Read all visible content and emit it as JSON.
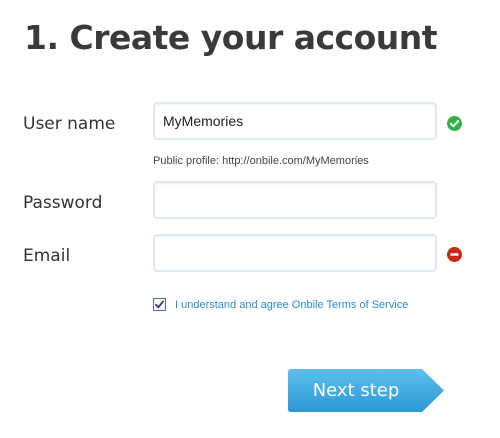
{
  "header": {
    "title": "1. Create your account"
  },
  "form": {
    "username": {
      "label": "User name",
      "value": "MyMemories",
      "status": "valid",
      "hint": "Public profile: http://onbile.com/MyMemories"
    },
    "password": {
      "label": "Password",
      "value": ""
    },
    "email": {
      "label": "Email",
      "value": "",
      "status": "error"
    },
    "terms": {
      "checked": true,
      "label": "I understand and agree Onbile Terms of Service"
    },
    "next_button": {
      "label": "Next step"
    }
  },
  "icons": {
    "valid": "check-circle-icon",
    "error": "minus-circle-icon"
  },
  "colors": {
    "accent": "#2b8dc8",
    "button_top": "#5ec0ec",
    "button_bottom": "#2b97d6",
    "valid": "#2fb344",
    "error": "#c62a18"
  }
}
